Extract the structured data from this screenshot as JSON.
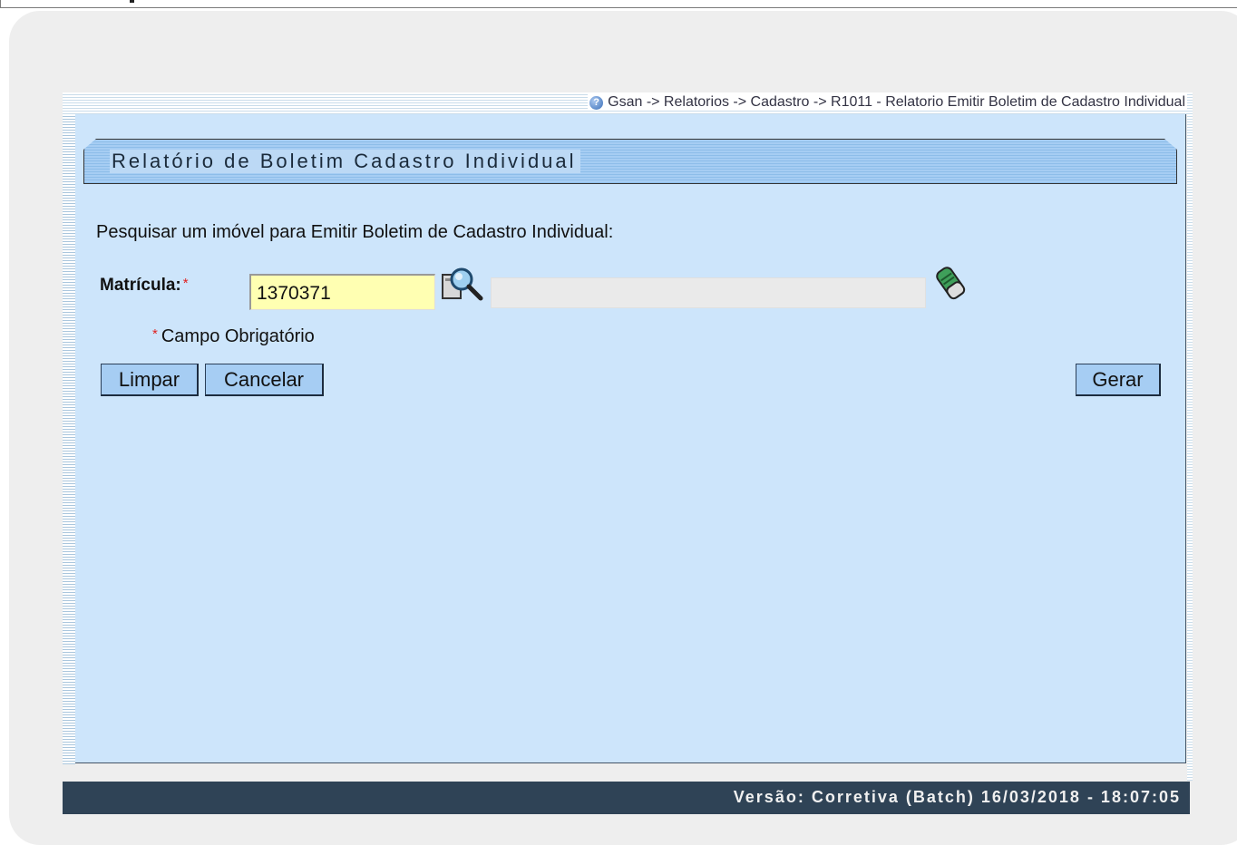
{
  "breadcrumb": {
    "text": "Gsan -> Relatorios -> Cadastro -> R1011 - Relatorio Emitir Boletim de Cadastro Individual",
    "icon": "help-icon"
  },
  "panel": {
    "title": "Relatório de Boletim Cadastro Individual",
    "prompt": "Pesquisar um imóvel para Emitir Boletim de Cadastro Individual:"
  },
  "form": {
    "matricula_label": "Matrícula:",
    "required_marker": "*",
    "matricula_value": "1370371",
    "description_value": "",
    "required_note": "Campo Obrigatório"
  },
  "buttons": {
    "limpar": "Limpar",
    "cancelar": "Cancelar",
    "gerar": "Gerar"
  },
  "footer": {
    "version": "Versão: Corretiva (Batch) 16/03/2018 - 18:07:05"
  },
  "colors": {
    "panel_bg": "#cde5fb",
    "button_bg": "#a6cdf3",
    "input_bg": "#ffffb2",
    "footer_bg": "#2f4356",
    "required": "#e02020"
  }
}
